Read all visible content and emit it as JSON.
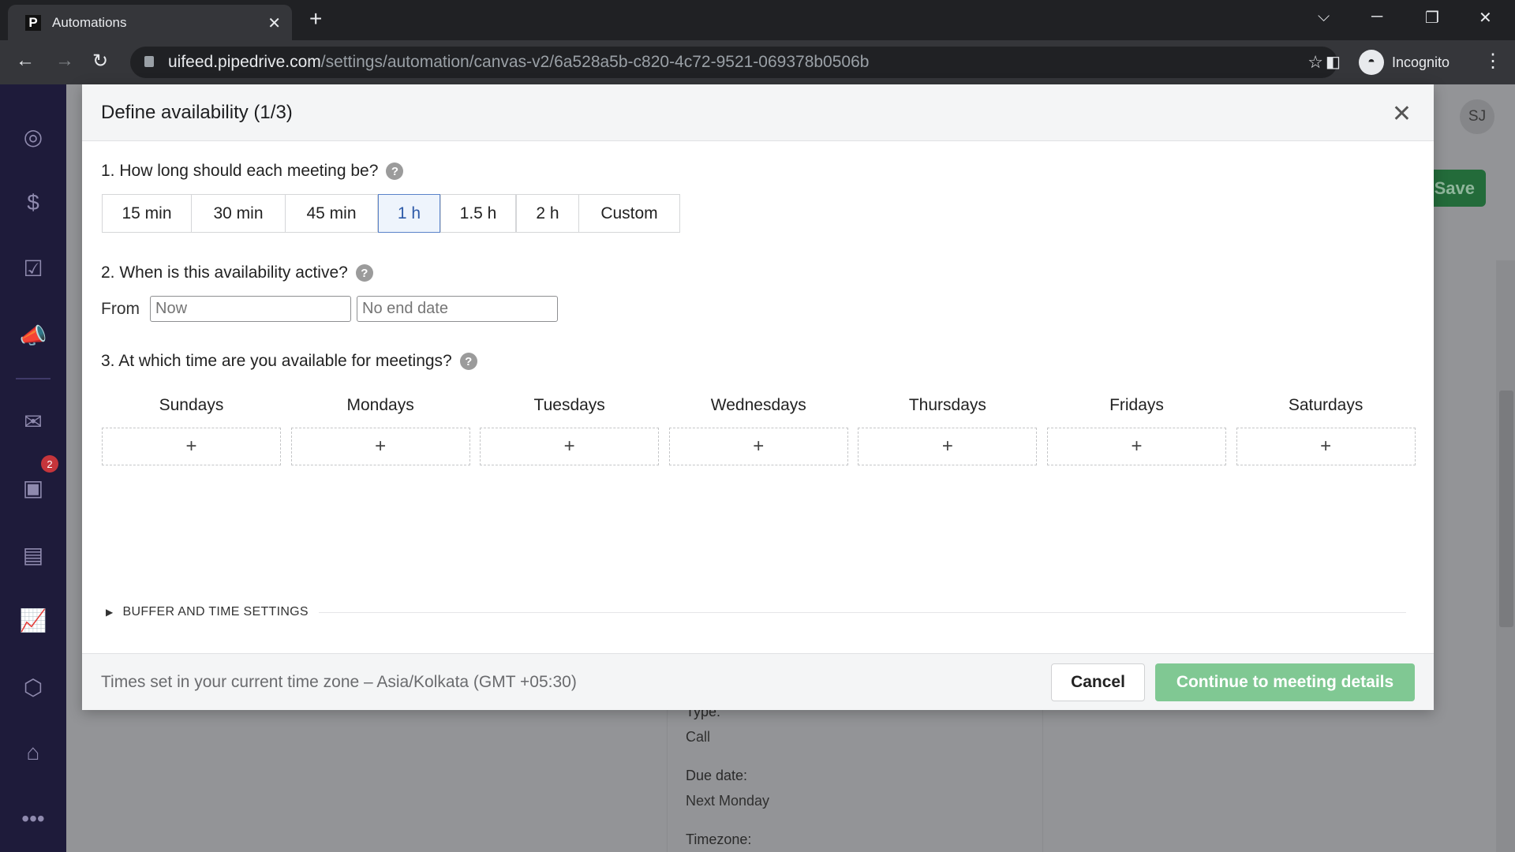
{
  "browser": {
    "tab_title": "Automations",
    "favicon": "P",
    "url_host": "uifeed.pipedrive.com",
    "url_path": "/settings/automation/canvas-v2/6a528a5b-c820-4c72-9521-069378b0506b",
    "profile": "Incognito"
  },
  "sidebar": {
    "icons": [
      "target-icon",
      "dollar-icon",
      "clipboard-check-icon",
      "megaphone-icon",
      "mail-icon",
      "calendar-icon",
      "contact-card-icon",
      "chart-icon",
      "box-icon",
      "store-icon",
      "more-icon"
    ],
    "calendar_badge": "2"
  },
  "background": {
    "avatar": "SJ",
    "save_label": "Save",
    "type_label": "Type:",
    "type_value": "Call",
    "due_label": "Due date:",
    "due_value": "Next Monday",
    "timezone_label": "Timezone:"
  },
  "modal": {
    "title": "Define availability (1/3)",
    "q1": "1. How long should each meeting be?",
    "durations": [
      "15 min",
      "30 min",
      "45 min",
      "1 h",
      "1.5 h",
      "2 h",
      "Custom"
    ],
    "selected_duration": "1 h",
    "q2": "2. When is this availability active?",
    "from_label": "From",
    "from_placeholder": "Now",
    "to_placeholder": "No end date",
    "q3": "3. At which time are you available for meetings?",
    "days": [
      "Sundays",
      "Mondays",
      "Tuesdays",
      "Wednesdays",
      "Thursdays",
      "Fridays",
      "Saturdays"
    ],
    "add_symbol": "+",
    "buffer_label": "BUFFER AND TIME SETTINGS",
    "timezone_note": "Times set in your current time zone – Asia/Kolkata (GMT +05:30)",
    "cancel_label": "Cancel",
    "continue_label": "Continue to meeting details"
  },
  "colors": {
    "sidebar": "#1e1b3a",
    "primary_green": "#80c893",
    "selected_blue": "#5a82c9"
  }
}
